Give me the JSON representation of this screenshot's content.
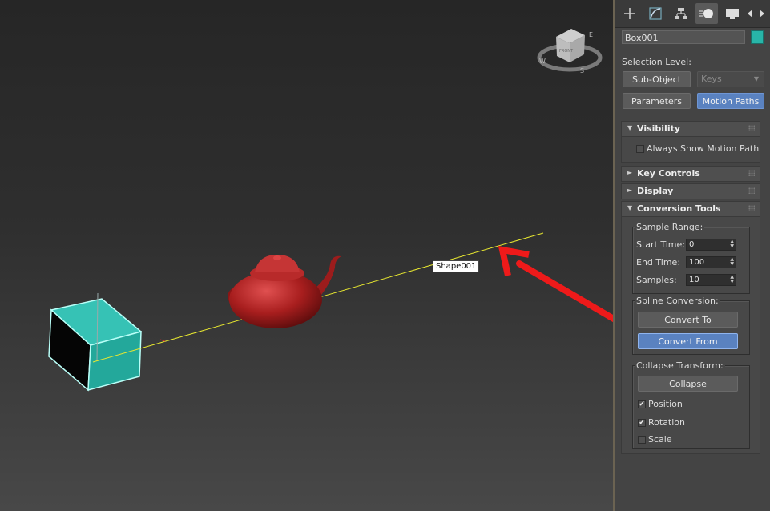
{
  "viewport": {
    "tooltip": "Shape001",
    "viewcube_face": "FRONT",
    "compass": {
      "west": "W",
      "south": "S",
      "east": "E"
    }
  },
  "command_panel": {
    "tabs": [
      {
        "icon": "create-plus-icon"
      },
      {
        "icon": "modify-curve-icon"
      },
      {
        "icon": "hierarchy-icon"
      },
      {
        "icon": "motion-icon",
        "active": true
      },
      {
        "icon": "display-monitor-icon"
      }
    ],
    "object_name": "Box001",
    "object_color": "#28b5a8",
    "selection_level": {
      "label": "Selection Level:",
      "sub_object_button": "Sub-Object",
      "sub_object_dropdown": "Keys",
      "parameters_button": "Parameters",
      "motion_paths_button": "Motion Paths"
    },
    "rollouts": {
      "visibility": {
        "title": "Visibility",
        "always_show_label": "Always Show Motion Path",
        "always_show_checked": false
      },
      "key_controls": {
        "title": "Key Controls"
      },
      "display": {
        "title": "Display"
      },
      "conversion_tools": {
        "title": "Conversion Tools",
        "sample_range": {
          "title": "Sample Range:",
          "start_time_label": "Start Time:",
          "start_time_value": "0",
          "end_time_label": "End Time:",
          "end_time_value": "100",
          "samples_label": "Samples:",
          "samples_value": "10"
        },
        "spline_conversion": {
          "title": "Spline Conversion:",
          "convert_to_button": "Convert To",
          "convert_from_button": "Convert From"
        },
        "collapse_transform": {
          "title": "Collapse Transform:",
          "collapse_button": "Collapse",
          "position_label": "Position",
          "position_checked": true,
          "rotation_label": "Rotation",
          "rotation_checked": true,
          "scale_label": "Scale",
          "scale_checked": false
        }
      }
    }
  },
  "colors": {
    "accent_blue": "#5a82c0",
    "box_cyan": "#28b5a8",
    "teapot_red": "#b52424",
    "path_yellow": "#e8e830",
    "arrow_red": "#ee1a1a"
  }
}
